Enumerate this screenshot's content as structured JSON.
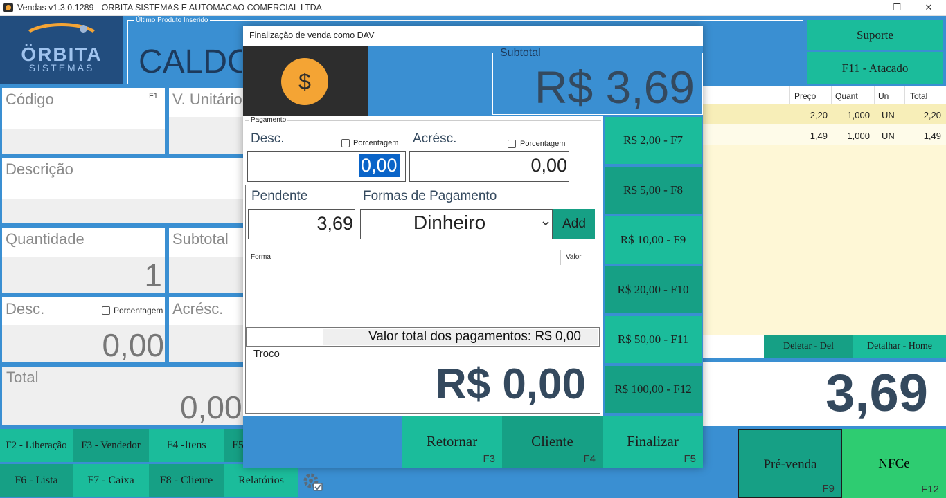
{
  "window": {
    "title": "Vendas v1.3.0.1289 - ORBITA SISTEMAS E AUTOMACAO COMERCIAL LTDA",
    "minimize": "—",
    "maximize": "❐",
    "close": "✕"
  },
  "logo": {
    "name": "ÖRBITA",
    "sub": "SISTEMAS"
  },
  "ultimo": {
    "label": "Último Produto Inserido",
    "value": "CALDO"
  },
  "top_buttons": {
    "suporte": "Suporte",
    "atacado": "F11 - Atacado"
  },
  "fields": {
    "codigo": {
      "label": "Código",
      "key": "F1"
    },
    "unitario": {
      "label": "V. Unitário"
    },
    "descricao": {
      "label": "Descrição"
    },
    "quantidade": {
      "label": "Quantidade",
      "value": "1"
    },
    "subtotal": {
      "label": "Subtotal"
    },
    "desc": {
      "label": "Desc.",
      "check": "Porcentagem",
      "value": "0,00"
    },
    "acresc": {
      "label": "Acrésc."
    },
    "total": {
      "label": "Total",
      "value": "0,00"
    }
  },
  "table": {
    "headers": [
      "Preço",
      "Quant",
      "Un",
      "Total"
    ],
    "rows": [
      {
        "preco": "2,20",
        "quant": "1,000",
        "un": "UN",
        "total": "2,20"
      },
      {
        "preco": "1,49",
        "quant": "1,000",
        "un": "UN",
        "total": "1,49"
      }
    ]
  },
  "table_buttons": {
    "deletar": "Deletar - Del",
    "detalhar": "Detalhar - Home"
  },
  "grand_total": "3,69",
  "modal": {
    "title": "Finalização de venda como DAV",
    "coin_symbol": "$",
    "subtotal_label": "Subtotal",
    "subtotal_value": "R$ 3,69",
    "pagamento_label": "Pagamento",
    "desc_label": "Desc.",
    "desc_check": "Porcentagem",
    "desc_value": "0,00",
    "acresc_label": "Acrésc.",
    "acresc_check": "Porcentagem",
    "acresc_value": "0,00",
    "pendente_label": "Pendente",
    "pendente_value": "3,69",
    "formas_label": "Formas de Pagamento",
    "forma_selected": "Dinheiro",
    "add": "Add",
    "col_forma": "Forma",
    "col_valor": "Valor",
    "total_pagamentos": "Valor total dos pagamentos: R$ 0,00",
    "troco_label": "Troco",
    "troco_value": "R$ 0,00",
    "quick": [
      "R$ 2,00 - F7",
      "R$ 5,00 - F8",
      "R$ 10,00 - F9",
      "R$ 20,00 - F10",
      "R$ 50,00 - F11",
      "R$ 100,00 - F12"
    ],
    "retornar": {
      "label": "Retornar",
      "key": "F3"
    },
    "cliente": {
      "label": "Cliente",
      "key": "F4"
    },
    "finalizar": {
      "label": "Finalizar",
      "key": "F5"
    }
  },
  "bottom": {
    "f2": "F2 - Liberação",
    "f3": "F3 - Vendedor",
    "f4": "F4 -Itens",
    "f5": "F5",
    "f6": "F6 - Lista",
    "f7": "F7 - Caixa",
    "f8": "F8 - Cliente",
    "relatorios": "Relatórios",
    "prevenda": {
      "label": "Pré-venda",
      "key": "F9"
    },
    "nfce": {
      "label": "NFCe",
      "key": "F12"
    }
  }
}
